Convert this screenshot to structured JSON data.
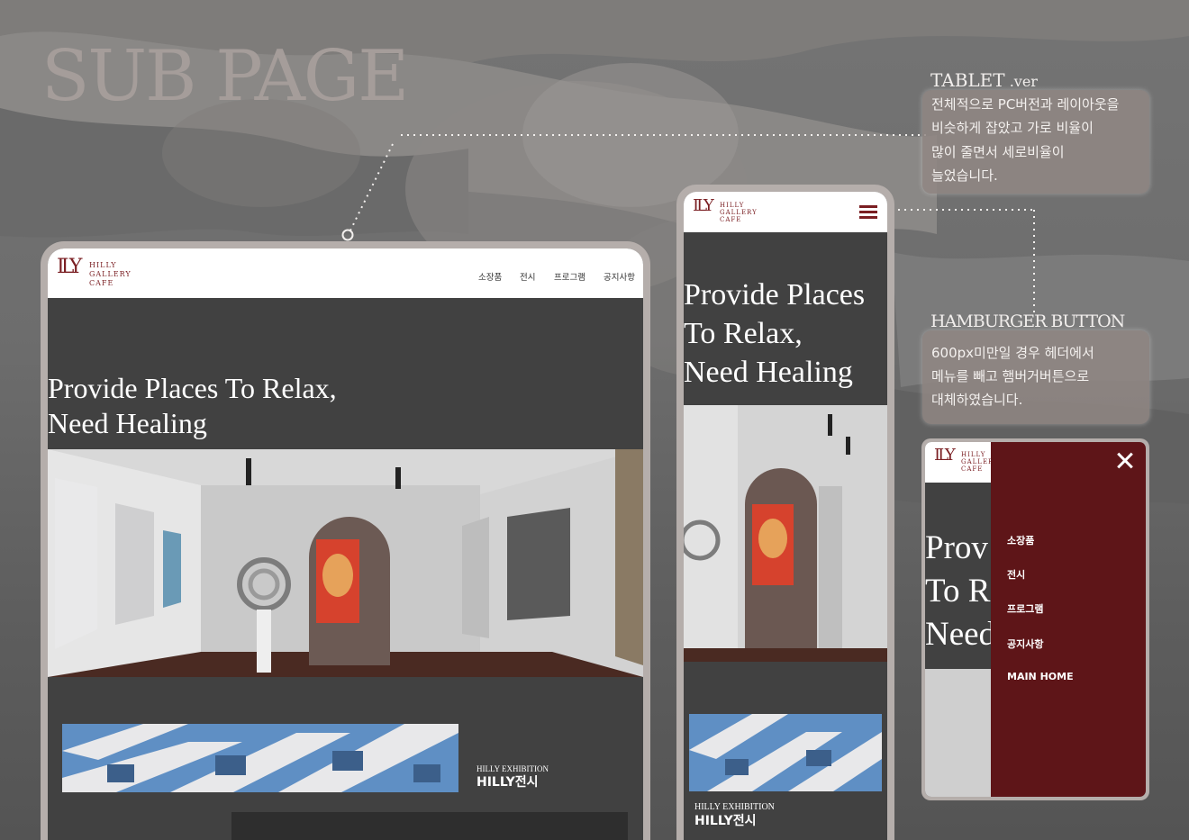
{
  "page_title": "SUB PAGE",
  "colors": {
    "brand": "#7a1e22",
    "menu_panel": "#5e1518",
    "dark_section": "#414141",
    "frame": "#b5aeab"
  },
  "tablet_callout": {
    "title_main": "TABLET",
    "title_suffix": " .ver",
    "lines": [
      "전체적으로 PC버전과 레이아웃을",
      "비슷하게 잡았고 가로 비율이",
      "많이 줄면서 세로비율이",
      "늘었습니다."
    ]
  },
  "hamburger_callout": {
    "title": "HAMBURGER BUTTON",
    "lines": [
      "600px미만일 경우 헤더에서",
      "메뉴를 빼고 햄버거버튼으로",
      "대체하였습니다."
    ]
  },
  "logo": {
    "mark": "ILY",
    "lines": [
      "HILLY",
      "GALLERY",
      "CAFE"
    ]
  },
  "nav_items": [
    "소장품",
    "전시",
    "프로그램",
    "공지사항"
  ],
  "tablet": {
    "hero_lines": [
      "Provide Places To Relax,",
      "Need Healing"
    ],
    "exhibition_sub": "HILLY EXHIBITION",
    "exhibition_main": "HILLY전시"
  },
  "mobile": {
    "hero_lines": [
      "Provide Places",
      "To Relax,",
      "Need Healing"
    ],
    "menu_icon": "hamburger-icon",
    "exhibition_sub": "HILLY EXHIBITION",
    "exhibition_main": "HILLY전시"
  },
  "mobile_menu": {
    "close_icon": "close-icon",
    "hero_lines": [
      "Prov",
      "To R",
      "Need"
    ],
    "items": [
      "소장품",
      "전시",
      "프로그램",
      "공지사항",
      "MAIN HOME"
    ]
  }
}
